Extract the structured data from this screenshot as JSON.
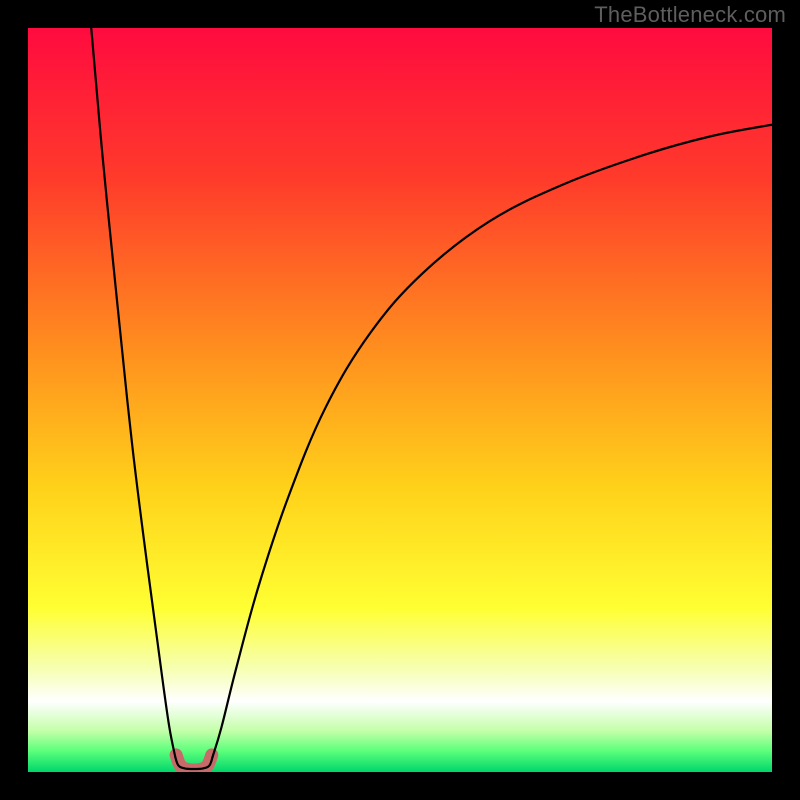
{
  "watermark": "TheBottleneck.com",
  "chart_data": {
    "type": "line",
    "title": "",
    "xlabel": "",
    "ylabel": "",
    "xlim": [
      0,
      100
    ],
    "ylim": [
      0,
      100
    ],
    "grid": false,
    "legend": false,
    "annotations": [],
    "gradient_stops": [
      {
        "pos": 0.0,
        "color": "#ff0b3f"
      },
      {
        "pos": 0.2,
        "color": "#ff3a2b"
      },
      {
        "pos": 0.42,
        "color": "#ff8a1f"
      },
      {
        "pos": 0.62,
        "color": "#ffd21a"
      },
      {
        "pos": 0.78,
        "color": "#ffff33"
      },
      {
        "pos": 0.86,
        "color": "#f6ffb0"
      },
      {
        "pos": 0.905,
        "color": "#ffffff"
      },
      {
        "pos": 0.945,
        "color": "#c3ffa8"
      },
      {
        "pos": 0.972,
        "color": "#5bff7a"
      },
      {
        "pos": 1.0,
        "color": "#00d66b"
      }
    ],
    "series": [
      {
        "name": "left-branch",
        "x": [
          8.5,
          10,
          12,
          14,
          16,
          18,
          19,
          19.8
        ],
        "values": [
          100,
          83,
          63,
          44,
          28,
          13,
          6,
          2
        ]
      },
      {
        "name": "valley",
        "x": [
          19.8,
          20.2,
          21.0,
          22.3,
          23.6,
          24.4,
          24.8
        ],
        "values": [
          2,
          0.9,
          0.5,
          0.4,
          0.5,
          0.9,
          2
        ]
      },
      {
        "name": "right-branch",
        "x": [
          24.8,
          26,
          28,
          31,
          35,
          40,
          46,
          53,
          62,
          72,
          83,
          92,
          100
        ],
        "values": [
          2,
          6,
          14,
          25,
          37,
          49,
          59,
          67,
          74,
          79,
          83,
          85.5,
          87
        ]
      }
    ],
    "valley_marker": {
      "color": "#c96a6a",
      "thickness_px": 13,
      "x": [
        19.9,
        20.4,
        21.1,
        22.3,
        23.5,
        24.2,
        24.7
      ],
      "values": [
        2.3,
        1.0,
        0.45,
        0.25,
        0.45,
        1.0,
        2.3
      ]
    }
  }
}
